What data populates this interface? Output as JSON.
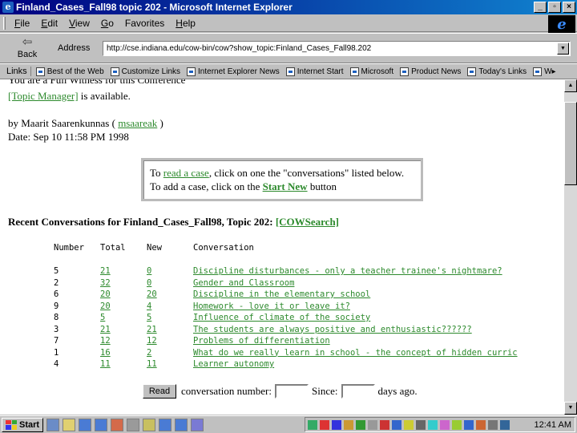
{
  "window": {
    "title": "Finland_Cases_Fall98 topic 202 - Microsoft Internet Explorer",
    "min": "_",
    "max": "▫",
    "close": "×"
  },
  "menu": [
    {
      "u": "F",
      "rest": "ile"
    },
    {
      "u": "E",
      "rest": "dit"
    },
    {
      "u": "V",
      "rest": "iew"
    },
    {
      "u": "G",
      "rest": "o"
    },
    {
      "u": "",
      "rest": "Favorites"
    },
    {
      "u": "H",
      "rest": "elp"
    }
  ],
  "toolbar": {
    "back": "Back",
    "address_label": "Address",
    "url": "http://cse.indiana.edu/cow-bin/cow?show_topic:Finland_Cases_Fall98.202"
  },
  "links": {
    "label": "Links",
    "items": [
      "Best of the Web",
      "Customize Links",
      "Internet Explorer News",
      "Internet Start",
      "Microsoft",
      "Product News",
      "Today's Links",
      "W"
    ]
  },
  "content": {
    "cut_line": "You are a Full Witness for this Conference",
    "topic_manager": "[Topic Manager]",
    "topic_manager_suffix": " is available.",
    "by_prefix": "by Maarit Saarenkunnas ( ",
    "by_user": "msaareak",
    "by_suffix": " )",
    "date": "Date: Sep 10 11:58 PM 1998",
    "box_line1_a": "To ",
    "box_line1_link": "read a case",
    "box_line1_b": ", click on one the \"conversations\" listed below.",
    "box_line2_a": "To add a case, click on the ",
    "box_line2_link": "Start New",
    "box_line2_b": " button",
    "recent_prefix": "Recent Conversations for Finland_Cases_Fall98, Topic 202: ",
    "cowsearch": "[COWSearch]",
    "table_headers": [
      "Number",
      "Total",
      "New",
      "Conversation"
    ],
    "rows": [
      {
        "number": "5",
        "total": "21",
        "new": "0",
        "conversation": "Discipline disturbances - only a teacher trainee's nightmare?"
      },
      {
        "number": "2",
        "total": "32",
        "new": "0",
        "conversation": "Gender and Classroom"
      },
      {
        "number": "6",
        "total": "20",
        "new": "20",
        "conversation": "Discipline in the elementary school "
      },
      {
        "number": "9",
        "total": "20",
        "new": "4",
        "conversation": "Homework -  love it or leave it?"
      },
      {
        "number": "8",
        "total": "5",
        "new": "5",
        "conversation": "Influence of climate of the society"
      },
      {
        "number": "3",
        "total": "21",
        "new": "21",
        "conversation": "The students are always positive and enthusiastic??????"
      },
      {
        "number": "7",
        "total": "12",
        "new": "12",
        "conversation": "Problems of differentiation"
      },
      {
        "number": "1",
        "total": "16",
        "new": "2",
        "conversation": "What do we really learn in school - the concept of hidden curric"
      },
      {
        "number": "4",
        "total": "11",
        "new": "11",
        "conversation": "Learner autonomy"
      }
    ],
    "read_button": "Read",
    "conv_label": "conversation number:",
    "since_label": "Since:",
    "days_label": "days ago."
  },
  "taskbar": {
    "start": "Start",
    "clock": "12:41 AM"
  },
  "colors": {
    "title_start": "#000080",
    "title_end": "#1084d0",
    "link": "#2d8a2d",
    "chrome": "#c0c0c0"
  }
}
